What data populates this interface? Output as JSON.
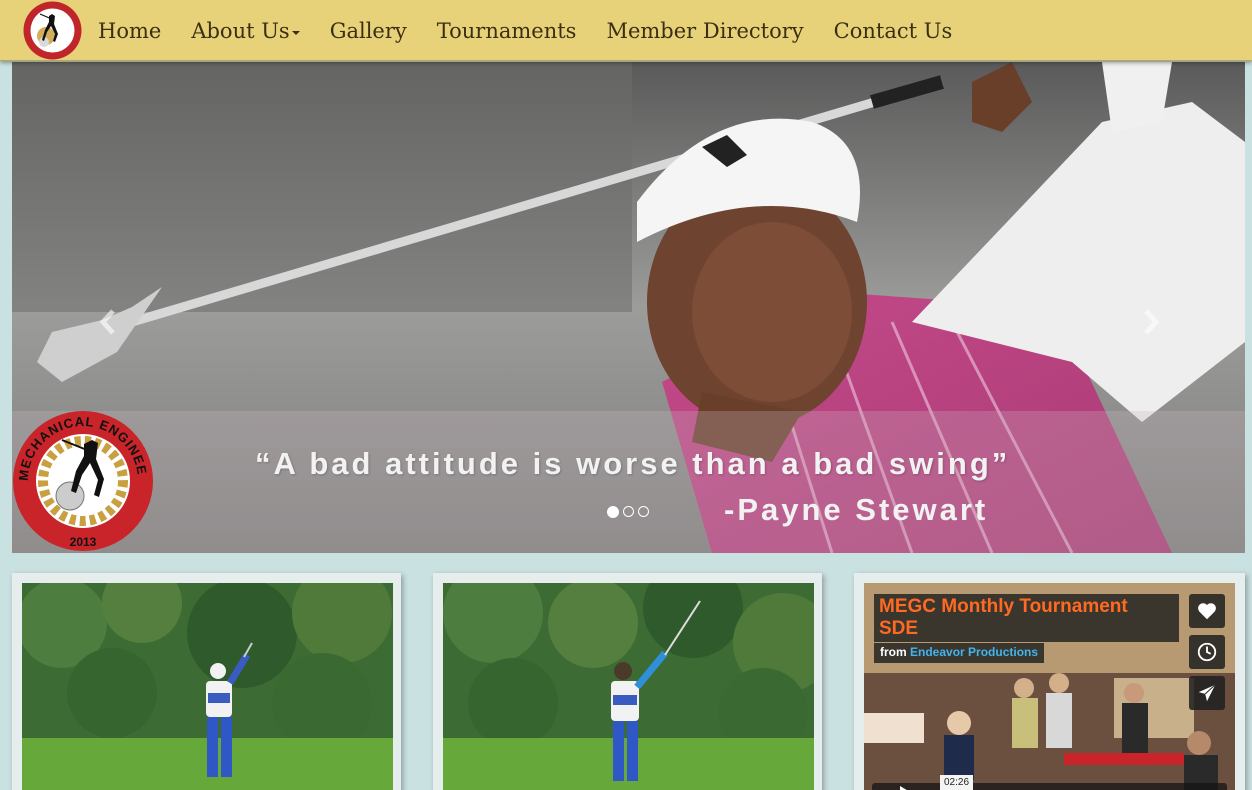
{
  "nav": {
    "items": [
      {
        "label": "Home"
      },
      {
        "label": "About Us"
      },
      {
        "label": "Gallery"
      },
      {
        "label": "Tournaments"
      },
      {
        "label": "Member Directory"
      },
      {
        "label": "Contact Us"
      }
    ],
    "logo_icon": "golf-club-logo-icon"
  },
  "carousel": {
    "quote": "“A bad attitude is worse than a bad swing”",
    "author": "-Payne Stewart",
    "slide_count": 3,
    "active_slide": 1,
    "prev_icon": "chevron-left-icon",
    "next_icon": "chevron-right-icon"
  },
  "logo": {
    "ring_text": "MECHANICAL ENGINEERS GOLF CLUB",
    "year": "2013"
  },
  "video": {
    "title": "MEGC Monthly Tournament SDE",
    "from_label": "from",
    "channel": "Endeavor Productions",
    "duration": "02:26",
    "like_icon": "heart-icon",
    "watch_later_icon": "clock-icon",
    "share_icon": "send-icon",
    "play_icon": "play-icon"
  },
  "colors": {
    "navbar_bg": "#e8d279",
    "page_bg": "#c9e1e1",
    "video_title": "#ff6a22",
    "video_channel": "#3fb6ee"
  }
}
